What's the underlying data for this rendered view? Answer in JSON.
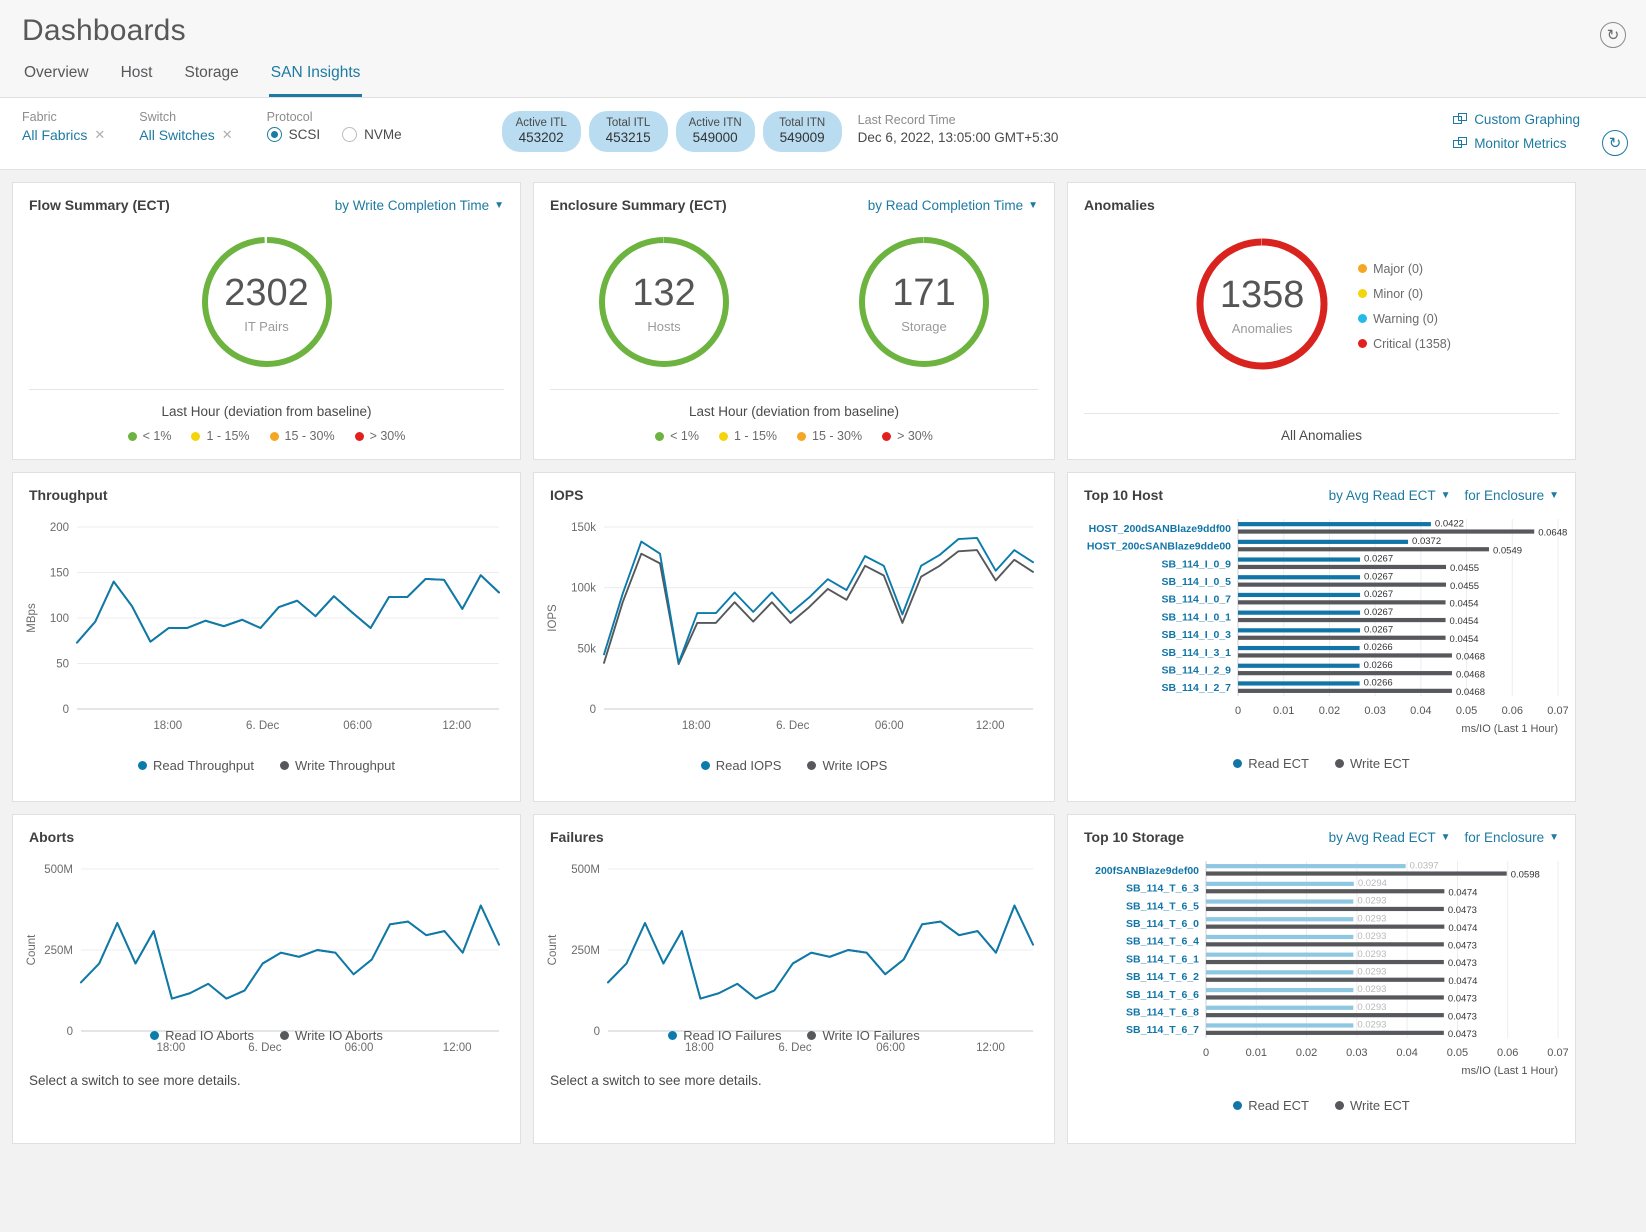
{
  "header": {
    "title": "Dashboards",
    "tabs": [
      {
        "label": "Overview",
        "active": false
      },
      {
        "label": "Host",
        "active": false
      },
      {
        "label": "Storage",
        "active": false
      },
      {
        "label": "SAN Insights",
        "active": true
      }
    ],
    "refresh_icon": "refresh-icon"
  },
  "filters": {
    "fabric": {
      "label": "Fabric",
      "value": "All Fabrics"
    },
    "switch": {
      "label": "Switch",
      "value": "All Switches"
    },
    "protocol": {
      "label": "Protocol",
      "options": [
        {
          "label": "SCSI",
          "selected": true
        },
        {
          "label": "NVMe",
          "selected": false
        }
      ]
    },
    "pills": [
      {
        "label": "Active ITL",
        "value": "453202"
      },
      {
        "label": "Total ITL",
        "value": "453215"
      },
      {
        "label": "Active ITN",
        "value": "549000"
      },
      {
        "label": "Total ITN",
        "value": "549009"
      }
    ],
    "last_record": {
      "label": "Last Record Time",
      "value": "Dec 6, 2022, 13:05:00 GMT+5:30"
    },
    "links": [
      {
        "label": "Custom Graphing",
        "icon": "graph-icon"
      },
      {
        "label": "Monitor Metrics",
        "icon": "graph-icon"
      }
    ],
    "refresh_icon": "refresh-icon"
  },
  "flow_summary": {
    "title": "Flow Summary (ECT)",
    "selector": "by Write Completion Time",
    "donut": {
      "value": "2302",
      "label": "IT Pairs",
      "color": "#6cb33f"
    },
    "footer_title": "Last Hour (deviation from baseline)",
    "legend": [
      {
        "label": "< 1%",
        "color": "#6cb33f"
      },
      {
        "label": "1 - 15%",
        "color": "#f4d40a"
      },
      {
        "label": "15 - 30%",
        "color": "#f5a623"
      },
      {
        "label": "> 30%",
        "color": "#e22020"
      }
    ]
  },
  "enclosure_summary": {
    "title": "Enclosure Summary (ECT)",
    "selector": "by Read Completion Time",
    "donuts": [
      {
        "value": "132",
        "label": "Hosts",
        "color": "#6cb33f"
      },
      {
        "value": "171",
        "label": "Storage",
        "color": "#6cb33f"
      }
    ],
    "footer_title": "Last Hour (deviation from baseline)",
    "legend": [
      {
        "label": "< 1%",
        "color": "#6cb33f"
      },
      {
        "label": "1 - 15%",
        "color": "#f4d40a"
      },
      {
        "label": "15 - 30%",
        "color": "#f5a623"
      },
      {
        "label": "> 30%",
        "color": "#e22020"
      }
    ]
  },
  "anomalies": {
    "title": "Anomalies",
    "donut": {
      "value": "1358",
      "label": "Anomalies",
      "color": "#d8231f"
    },
    "legend": [
      {
        "label": "Major (0)",
        "color": "#f5a623"
      },
      {
        "label": "Minor (0)",
        "color": "#f4d40a"
      },
      {
        "label": "Warning (0)",
        "color": "#23b9e8"
      },
      {
        "label": "Critical (1358)",
        "color": "#e22020"
      }
    ],
    "footer_title": "All Anomalies"
  },
  "chart_data": [
    {
      "id": "throughput",
      "type": "line",
      "title": "Throughput",
      "xlabel": "",
      "ylabel": "MBps",
      "ylim": [
        0,
        200
      ],
      "yticks": [
        "0",
        "50",
        "100",
        "150",
        "200"
      ],
      "xticks": [
        "18:00",
        "6. Dec",
        "06:00",
        "12:00"
      ],
      "grid": true,
      "legend_position": "bottom",
      "series": [
        {
          "name": "Read Throughput",
          "color": "#0a7bab",
          "values": [
            73,
            96,
            140,
            113,
            74,
            89,
            89,
            97,
            91,
            98,
            89,
            112,
            119,
            102,
            124,
            106,
            89,
            123,
            123,
            143,
            142,
            110,
            147,
            128
          ]
        },
        {
          "name": "Write Throughput",
          "color": "#57585b",
          "values": [
            73,
            96,
            140,
            113,
            74,
            89,
            89,
            97,
            91,
            98,
            89,
            112,
            119,
            102,
            124,
            106,
            89,
            123,
            123,
            143,
            142,
            110,
            147,
            128
          ]
        }
      ]
    },
    {
      "id": "iops",
      "type": "line",
      "title": "IOPS",
      "xlabel": "",
      "ylabel": "IOPS",
      "ylim": [
        0,
        150000
      ],
      "yticks": [
        "0",
        "50k",
        "100k",
        "150k"
      ],
      "xticks": [
        "18:00",
        "6. Dec",
        "06:00",
        "12:00"
      ],
      "grid": true,
      "legend_position": "bottom",
      "series": [
        {
          "name": "Read IOPS",
          "color": "#0a7bab",
          "values": [
            45000,
            95000,
            138000,
            128000,
            38000,
            79000,
            79000,
            96000,
            80000,
            96000,
            79000,
            92000,
            107000,
            98000,
            126000,
            118000,
            78000,
            118000,
            127000,
            140000,
            141000,
            114000,
            131000,
            121000
          ]
        },
        {
          "name": "Write IOPS",
          "color": "#57585b",
          "values": [
            38000,
            88000,
            128000,
            120000,
            37000,
            71000,
            71000,
            88000,
            72000,
            88000,
            71000,
            84000,
            99000,
            90000,
            118000,
            110000,
            71000,
            109000,
            118000,
            130000,
            131000,
            106000,
            123000,
            113000
          ]
        }
      ]
    },
    {
      "id": "aborts",
      "type": "line",
      "title": "Aborts",
      "xlabel": "",
      "ylabel": "Count",
      "ylim": [
        0,
        500000000
      ],
      "yticks": [
        "0",
        "250M",
        "500M"
      ],
      "xticks": [
        "18:00",
        "6. Dec",
        "06:00",
        "12:00"
      ],
      "grid": true,
      "legend_position": "bottom",
      "note": "Select a switch to see more details.",
      "series": [
        {
          "name": "Read IO Aborts",
          "color": "#0a7bab",
          "values": [
            180,
            250,
            400,
            250,
            370,
            120,
            140,
            175,
            120,
            150,
            250,
            290,
            275,
            300,
            290,
            210,
            265,
            395,
            405,
            355,
            370,
            290,
            465,
            320
          ]
        },
        {
          "name": "Write IO Aborts",
          "color": "#57585b",
          "values": [
            180,
            250,
            400,
            250,
            370,
            120,
            140,
            175,
            120,
            150,
            250,
            290,
            275,
            300,
            290,
            210,
            265,
            395,
            405,
            355,
            370,
            290,
            465,
            320
          ]
        }
      ]
    },
    {
      "id": "failures",
      "type": "line",
      "title": "Failures",
      "xlabel": "",
      "ylabel": "Count",
      "ylim": [
        0,
        500000000
      ],
      "yticks": [
        "0",
        "250M",
        "500M"
      ],
      "xticks": [
        "18:00",
        "6. Dec",
        "06:00",
        "12:00"
      ],
      "grid": true,
      "legend_position": "bottom",
      "note": "Select a switch to see more details.",
      "series": [
        {
          "name": "Read IO Failures",
          "color": "#0a7bab",
          "values": [
            180,
            250,
            400,
            250,
            370,
            120,
            140,
            175,
            120,
            150,
            250,
            290,
            275,
            300,
            290,
            210,
            265,
            395,
            405,
            355,
            370,
            290,
            465,
            320
          ]
        },
        {
          "name": "Write IO Failures",
          "color": "#57585b",
          "values": [
            180,
            250,
            400,
            250,
            370,
            120,
            140,
            175,
            120,
            150,
            250,
            290,
            275,
            300,
            290,
            210,
            265,
            395,
            405,
            355,
            370,
            290,
            465,
            320
          ]
        }
      ]
    },
    {
      "id": "top10host",
      "type": "bar",
      "title": "Top 10 Host",
      "selector_metric": "by Avg Read ECT",
      "selector_scope": "for Enclosure",
      "xlabel": "ms/IO (Last 1 Hour)",
      "xlim": [
        0,
        0.07
      ],
      "xticks": [
        "0",
        "0.01",
        "0.02",
        "0.03",
        "0.04",
        "0.05",
        "0.06",
        "0.07"
      ],
      "categories": [
        "HOST_200dSANBlaze9ddf00",
        "HOST_200cSANBlaze9dde00",
        "SB_114_I_0_9",
        "SB_114_I_0_5",
        "SB_114_I_0_7",
        "SB_114_I_0_1",
        "SB_114_I_0_3",
        "SB_114_I_3_1",
        "SB_114_I_2_9",
        "SB_114_I_2_7"
      ],
      "series": [
        {
          "name": "Read ECT",
          "color": "#1275a8",
          "values": [
            0.0422,
            0.0372,
            0.0267,
            0.0267,
            0.0267,
            0.0267,
            0.0267,
            0.0266,
            0.0266,
            0.0266
          ]
        },
        {
          "name": "Write ECT",
          "color": "#57585b",
          "values": [
            0.0648,
            0.0549,
            0.0455,
            0.0455,
            0.0454,
            0.0454,
            0.0454,
            0.0468,
            0.0468,
            0.0468
          ]
        }
      ]
    },
    {
      "id": "top10storage",
      "type": "bar",
      "title": "Top 10 Storage",
      "selector_metric": "by Avg Read ECT",
      "selector_scope": "for Enclosure",
      "xlabel": "ms/IO (Last 1 Hour)",
      "xlim": [
        0,
        0.07
      ],
      "xticks": [
        "0",
        "0.01",
        "0.02",
        "0.03",
        "0.04",
        "0.05",
        "0.06",
        "0.07"
      ],
      "categories": [
        "200fSANBlaze9def00",
        "SB_114_T_6_3",
        "SB_114_T_6_5",
        "SB_114_T_6_0",
        "SB_114_T_6_4",
        "SB_114_T_6_1",
        "SB_114_T_6_2",
        "SB_114_T_6_6",
        "SB_114_T_6_8",
        "SB_114_T_6_7"
      ],
      "series": [
        {
          "name": "Read ECT",
          "color": "#8ec7e2",
          "values": [
            0.0397,
            0.0294,
            0.0293,
            0.0293,
            0.0293,
            0.0293,
            0.0293,
            0.0293,
            0.0293,
            0.0293
          ]
        },
        {
          "name": "Write ECT",
          "color": "#57585b",
          "values": [
            0.0598,
            0.0474,
            0.0473,
            0.0474,
            0.0473,
            0.0473,
            0.0474,
            0.0473,
            0.0473,
            0.0473
          ]
        }
      ]
    }
  ]
}
